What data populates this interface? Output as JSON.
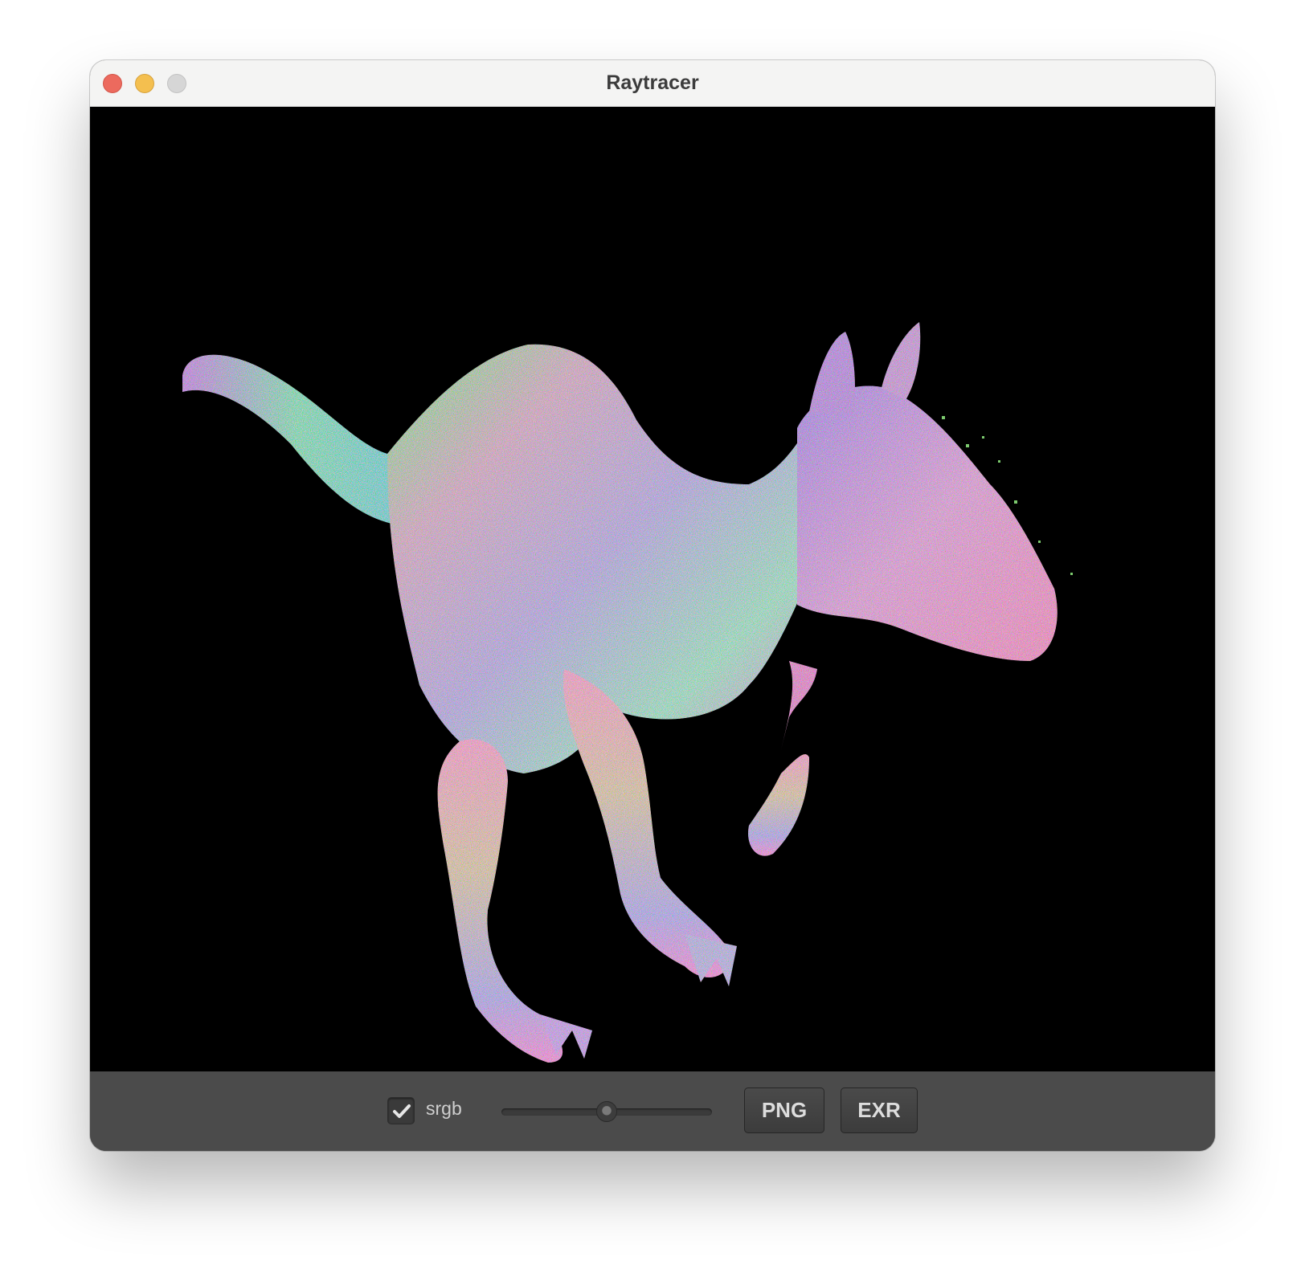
{
  "window": {
    "title": "Raytracer"
  },
  "viewport": {
    "render_description_icon": "kangaroo-normal-map-render"
  },
  "toolbar": {
    "checkbox_label": "srgb",
    "checkbox_checked": true,
    "exposure_slider_fraction": 0.5,
    "png_button": "PNG",
    "exr_button": "EXR"
  },
  "colors": {
    "titlebar": "#f4f4f3",
    "viewport_bg": "#000000",
    "toolbar_bg": "#4b4b4b",
    "close": "#ec6a5e",
    "minimize": "#f4bf4f",
    "zoom": "#d6d6d6"
  }
}
